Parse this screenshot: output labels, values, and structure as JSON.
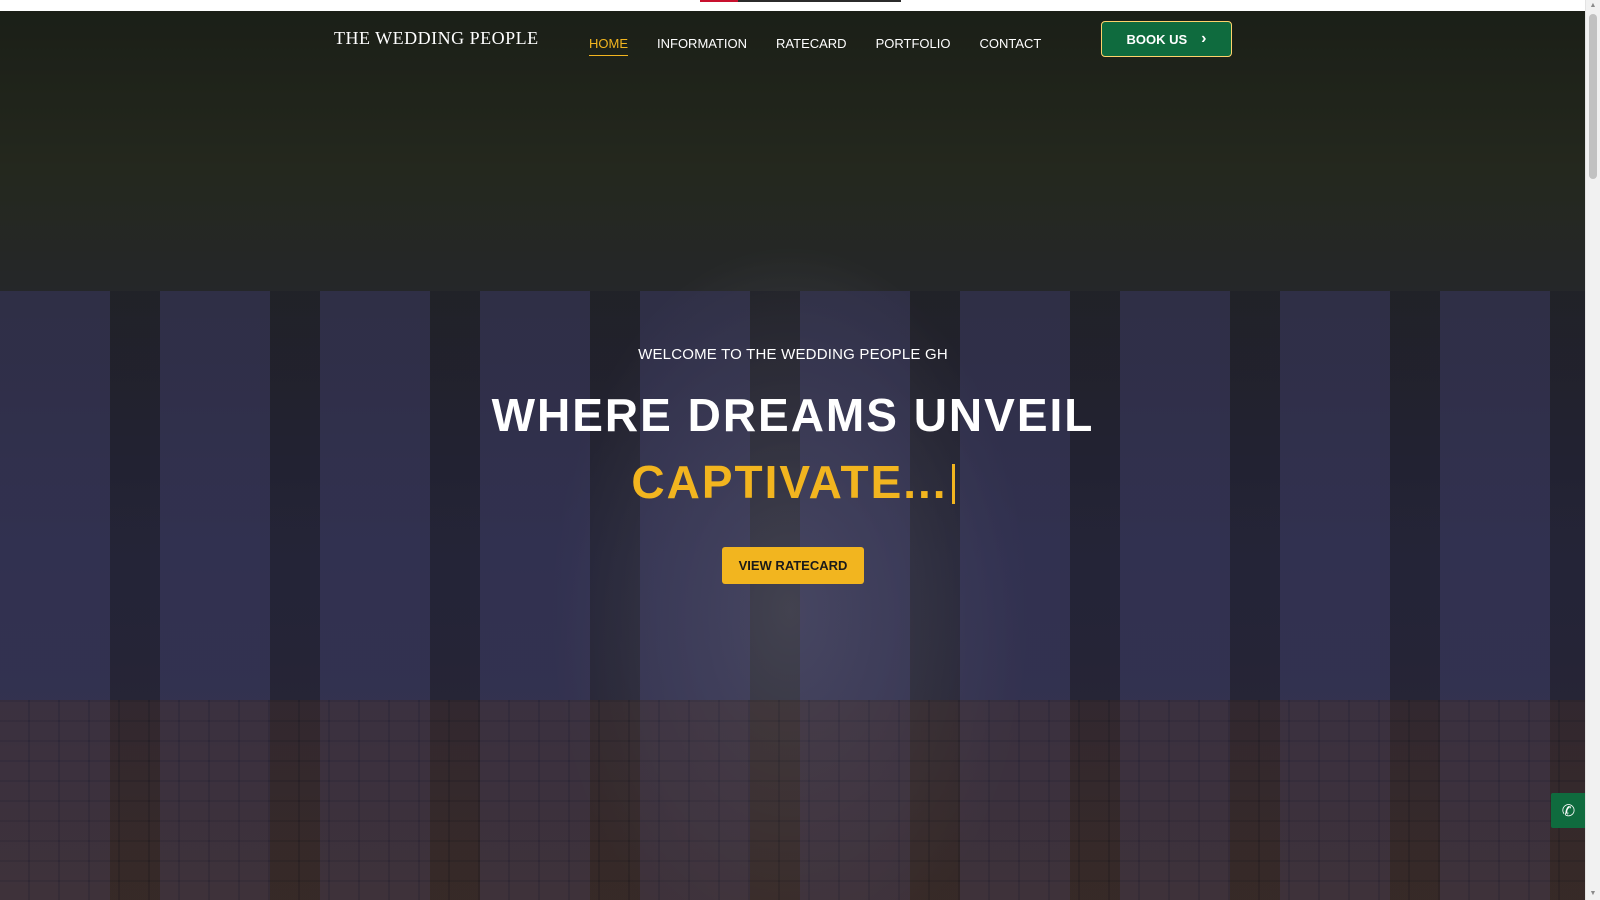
{
  "header": {
    "logo_text": "The Wedding People",
    "nav": [
      {
        "label": "HOME",
        "active": true
      },
      {
        "label": "INFORMATION",
        "active": false
      },
      {
        "label": "RATECARD",
        "active": false
      },
      {
        "label": "PORTFOLIO",
        "active": false
      },
      {
        "label": "CONTACT",
        "active": false
      }
    ],
    "book_button": {
      "label": "BOOK US",
      "icon": "chevron-right-icon"
    }
  },
  "hero": {
    "welcome": "WELCOME TO THE WEDDING PEOPLE GH",
    "headline_line1": "WHERE DREAMS UNVEIL",
    "headline_line2": "CAPTIVATE...",
    "cta_label": "VIEW RATECARD"
  },
  "floating": {
    "phone_icon": "phone-icon"
  },
  "colors": {
    "accent_gold": "#f2b51f",
    "brand_green": "#0f6b3e",
    "text_white": "#ffffff"
  },
  "load_progress": 0.19
}
